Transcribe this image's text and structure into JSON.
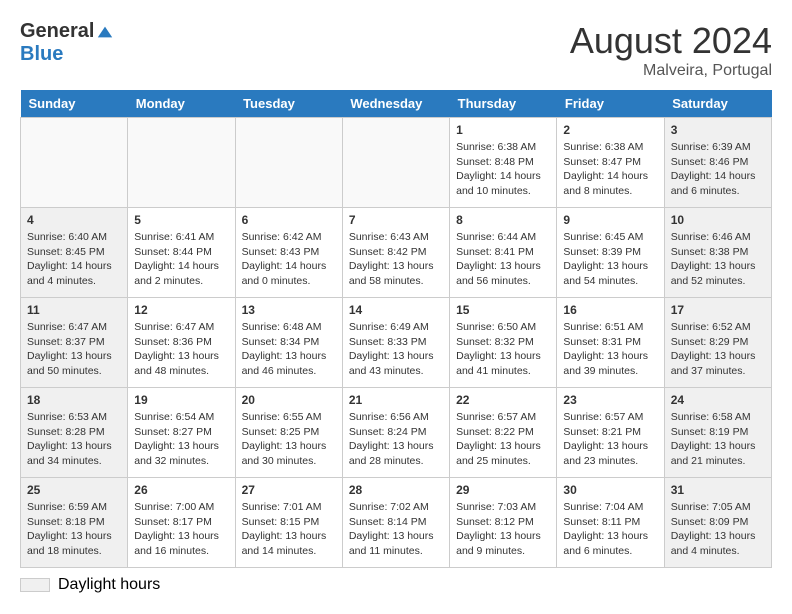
{
  "header": {
    "logo_general": "General",
    "logo_blue": "Blue",
    "month_year": "August 2024",
    "location": "Malveira, Portugal"
  },
  "days_of_week": [
    "Sunday",
    "Monday",
    "Tuesday",
    "Wednesday",
    "Thursday",
    "Friday",
    "Saturday"
  ],
  "weeks": [
    [
      {
        "day": "",
        "content": ""
      },
      {
        "day": "",
        "content": ""
      },
      {
        "day": "",
        "content": ""
      },
      {
        "day": "",
        "content": ""
      },
      {
        "day": "1",
        "content": "Sunrise: 6:38 AM\nSunset: 8:48 PM\nDaylight: 14 hours and 10 minutes."
      },
      {
        "day": "2",
        "content": "Sunrise: 6:38 AM\nSunset: 8:47 PM\nDaylight: 14 hours and 8 minutes."
      },
      {
        "day": "3",
        "content": "Sunrise: 6:39 AM\nSunset: 8:46 PM\nDaylight: 14 hours and 6 minutes."
      }
    ],
    [
      {
        "day": "4",
        "content": "Sunrise: 6:40 AM\nSunset: 8:45 PM\nDaylight: 14 hours and 4 minutes."
      },
      {
        "day": "5",
        "content": "Sunrise: 6:41 AM\nSunset: 8:44 PM\nDaylight: 14 hours and 2 minutes."
      },
      {
        "day": "6",
        "content": "Sunrise: 6:42 AM\nSunset: 8:43 PM\nDaylight: 14 hours and 0 minutes."
      },
      {
        "day": "7",
        "content": "Sunrise: 6:43 AM\nSunset: 8:42 PM\nDaylight: 13 hours and 58 minutes."
      },
      {
        "day": "8",
        "content": "Sunrise: 6:44 AM\nSunset: 8:41 PM\nDaylight: 13 hours and 56 minutes."
      },
      {
        "day": "9",
        "content": "Sunrise: 6:45 AM\nSunset: 8:39 PM\nDaylight: 13 hours and 54 minutes."
      },
      {
        "day": "10",
        "content": "Sunrise: 6:46 AM\nSunset: 8:38 PM\nDaylight: 13 hours and 52 minutes."
      }
    ],
    [
      {
        "day": "11",
        "content": "Sunrise: 6:47 AM\nSunset: 8:37 PM\nDaylight: 13 hours and 50 minutes."
      },
      {
        "day": "12",
        "content": "Sunrise: 6:47 AM\nSunset: 8:36 PM\nDaylight: 13 hours and 48 minutes."
      },
      {
        "day": "13",
        "content": "Sunrise: 6:48 AM\nSunset: 8:34 PM\nDaylight: 13 hours and 46 minutes."
      },
      {
        "day": "14",
        "content": "Sunrise: 6:49 AM\nSunset: 8:33 PM\nDaylight: 13 hours and 43 minutes."
      },
      {
        "day": "15",
        "content": "Sunrise: 6:50 AM\nSunset: 8:32 PM\nDaylight: 13 hours and 41 minutes."
      },
      {
        "day": "16",
        "content": "Sunrise: 6:51 AM\nSunset: 8:31 PM\nDaylight: 13 hours and 39 minutes."
      },
      {
        "day": "17",
        "content": "Sunrise: 6:52 AM\nSunset: 8:29 PM\nDaylight: 13 hours and 37 minutes."
      }
    ],
    [
      {
        "day": "18",
        "content": "Sunrise: 6:53 AM\nSunset: 8:28 PM\nDaylight: 13 hours and 34 minutes."
      },
      {
        "day": "19",
        "content": "Sunrise: 6:54 AM\nSunset: 8:27 PM\nDaylight: 13 hours and 32 minutes."
      },
      {
        "day": "20",
        "content": "Sunrise: 6:55 AM\nSunset: 8:25 PM\nDaylight: 13 hours and 30 minutes."
      },
      {
        "day": "21",
        "content": "Sunrise: 6:56 AM\nSunset: 8:24 PM\nDaylight: 13 hours and 28 minutes."
      },
      {
        "day": "22",
        "content": "Sunrise: 6:57 AM\nSunset: 8:22 PM\nDaylight: 13 hours and 25 minutes."
      },
      {
        "day": "23",
        "content": "Sunrise: 6:57 AM\nSunset: 8:21 PM\nDaylight: 13 hours and 23 minutes."
      },
      {
        "day": "24",
        "content": "Sunrise: 6:58 AM\nSunset: 8:19 PM\nDaylight: 13 hours and 21 minutes."
      }
    ],
    [
      {
        "day": "25",
        "content": "Sunrise: 6:59 AM\nSunset: 8:18 PM\nDaylight: 13 hours and 18 minutes."
      },
      {
        "day": "26",
        "content": "Sunrise: 7:00 AM\nSunset: 8:17 PM\nDaylight: 13 hours and 16 minutes."
      },
      {
        "day": "27",
        "content": "Sunrise: 7:01 AM\nSunset: 8:15 PM\nDaylight: 13 hours and 14 minutes."
      },
      {
        "day": "28",
        "content": "Sunrise: 7:02 AM\nSunset: 8:14 PM\nDaylight: 13 hours and 11 minutes."
      },
      {
        "day": "29",
        "content": "Sunrise: 7:03 AM\nSunset: 8:12 PM\nDaylight: 13 hours and 9 minutes."
      },
      {
        "day": "30",
        "content": "Sunrise: 7:04 AM\nSunset: 8:11 PM\nDaylight: 13 hours and 6 minutes."
      },
      {
        "day": "31",
        "content": "Sunrise: 7:05 AM\nSunset: 8:09 PM\nDaylight: 13 hours and 4 minutes."
      }
    ]
  ],
  "legend": {
    "daylight_label": "Daylight hours"
  }
}
